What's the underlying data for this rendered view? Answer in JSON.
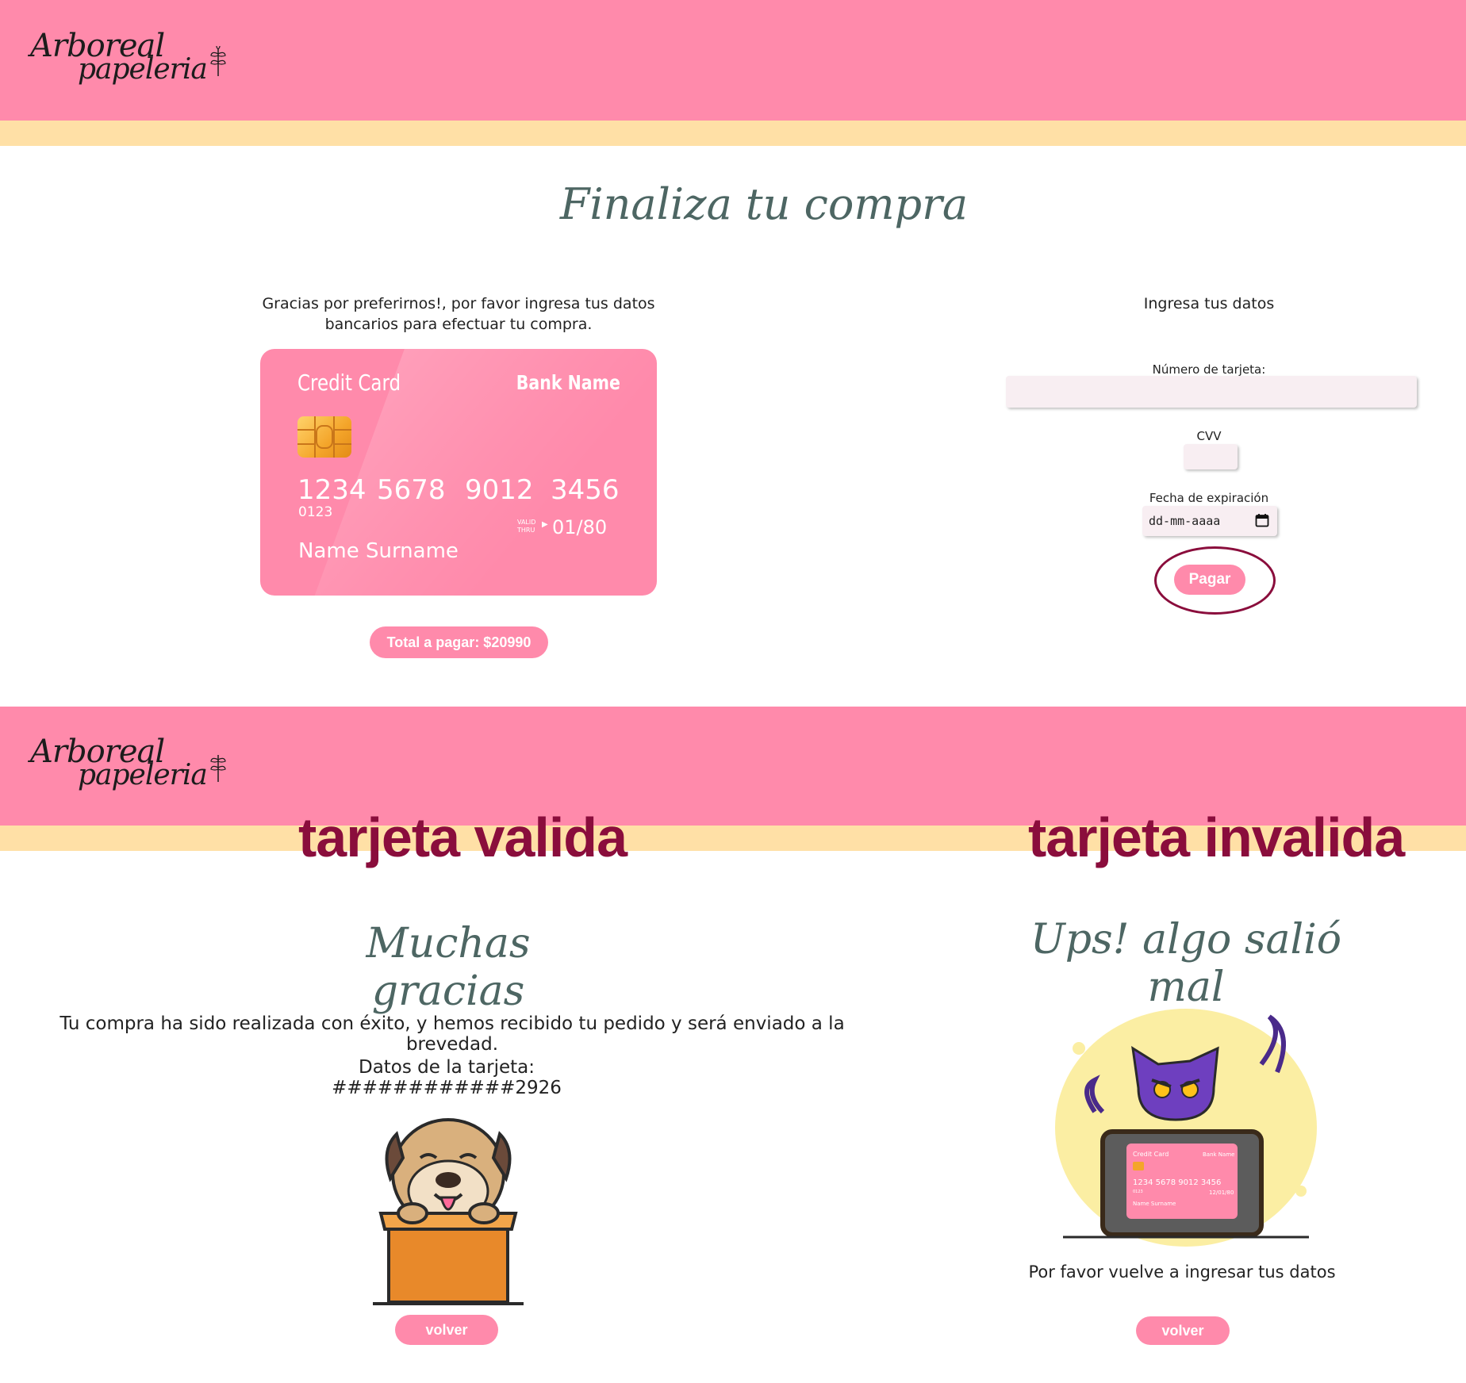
{
  "brand": {
    "line1": "Arboreal",
    "line2": "papeleria"
  },
  "checkout": {
    "title": "Finaliza tu compra",
    "intro_line1": "Gracias por preferirnos!, por favor ingresa tus datos",
    "intro_line2": "bancarios para efectuar tu compra.",
    "card": {
      "label": "Credit Card",
      "bank": "Bank Name",
      "number_groups": [
        "1234",
        "5678",
        "9012",
        "3456"
      ],
      "small_code": "0123",
      "valid_label_1": "VALID",
      "valid_label_2": "THRU",
      "expiry": "01/80",
      "holder": "Name Surname"
    },
    "total_button": "Total a pagar: $20990",
    "form": {
      "heading": "Ingresa tus datos",
      "card_number_label": "Número de tarjeta:",
      "card_number_value": "",
      "cvv_label": "CVV",
      "cvv_value": "",
      "expiry_label": "Fecha de expiración",
      "expiry_placeholder": "dd-mm-aaaa",
      "pay_button": "Pagar"
    }
  },
  "annotations": {
    "valid": "tarjeta valida",
    "invalid": "tarjeta invalida"
  },
  "success": {
    "title": "Muchas gracias",
    "message": "Tu compra ha sido realizada con éxito, y hemos recibido tu pedido y será enviado a la brevedad.",
    "card_info": "Datos de la tarjeta: ############2926",
    "back_button": "volver"
  },
  "error": {
    "title": "Ups! algo salió mal",
    "message": "Por favor vuelve a ingresar tus datos",
    "back_button": "volver",
    "illustration_card": {
      "label": "Credit Card",
      "bank": "Bank Name",
      "number": "1234 5678 9012 3456",
      "code": "0123",
      "expiry": "12/01/80",
      "holder": "Name Surname"
    }
  },
  "colors": {
    "header": "#ff8aab",
    "stripe": "#ffe0a6",
    "accent": "#8a0d3c",
    "title": "#4d6663",
    "button": "#ff8aab"
  }
}
